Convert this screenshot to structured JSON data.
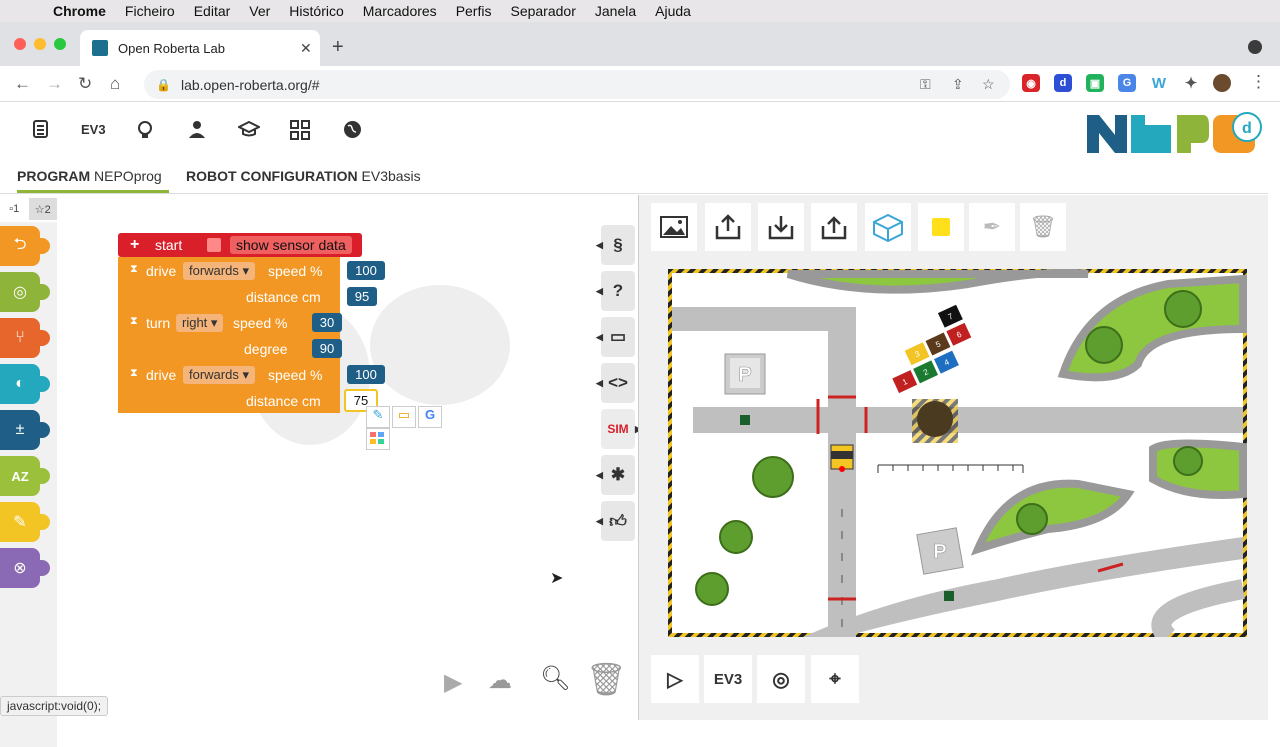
{
  "macmenu": {
    "app": "Chrome",
    "items": [
      "Ficheiro",
      "Editar",
      "Ver",
      "Histórico",
      "Marcadores",
      "Perfis",
      "Separador",
      "Janela",
      "Ajuda"
    ]
  },
  "browser": {
    "tab_title": "Open Roberta Lab",
    "url": "lab.open-roberta.org/#",
    "status": "javascript:void(0);"
  },
  "app": {
    "header_icons": [
      "menu-icon",
      "ev3-label",
      "lightbulb-icon",
      "user-icon",
      "graduation-icon",
      "gallery-icon",
      "globe-icon"
    ],
    "ev3_label": "EV3",
    "tabs": {
      "program_label": "PROGRAM",
      "program_name": "NEPOprog",
      "config_label": "ROBOT CONFIGURATION",
      "config_name": "EV3basis"
    },
    "toolbox": {
      "level1": "1",
      "level2": "2",
      "categories": [
        "action",
        "sensors",
        "control",
        "logic",
        "math",
        "text",
        "colour",
        "variables"
      ],
      "colors": [
        "#f29724",
        "#8fb43a",
        "#e6662b",
        "#23a8bd",
        "#1f5e86",
        "#9ac03c",
        "#f2c525",
        "#8a6ab4"
      ]
    },
    "blocks": {
      "start": "start",
      "show_sensor": "show sensor data",
      "drive1": {
        "label": "drive",
        "dir": "forwards",
        "speed_label": "speed %",
        "speed": "100",
        "dist_label": "distance cm",
        "dist": "95"
      },
      "turn": {
        "label": "turn",
        "dir": "right",
        "speed_label": "speed %",
        "speed": "30",
        "deg_label": "degree",
        "deg": "90"
      },
      "drive2": {
        "label": "drive",
        "dir": "forwards",
        "speed_label": "speed %",
        "speed": "100",
        "dist_label": "distance cm",
        "dist": "75"
      }
    },
    "sidebar": {
      "sim_label": "SIM"
    },
    "sim_bottom": {
      "ev3_label": "EV3"
    },
    "sim_labels": {
      "parking": "P",
      "tiles": [
        "1",
        "2",
        "3",
        "4",
        "5",
        "6",
        "7"
      ]
    }
  }
}
